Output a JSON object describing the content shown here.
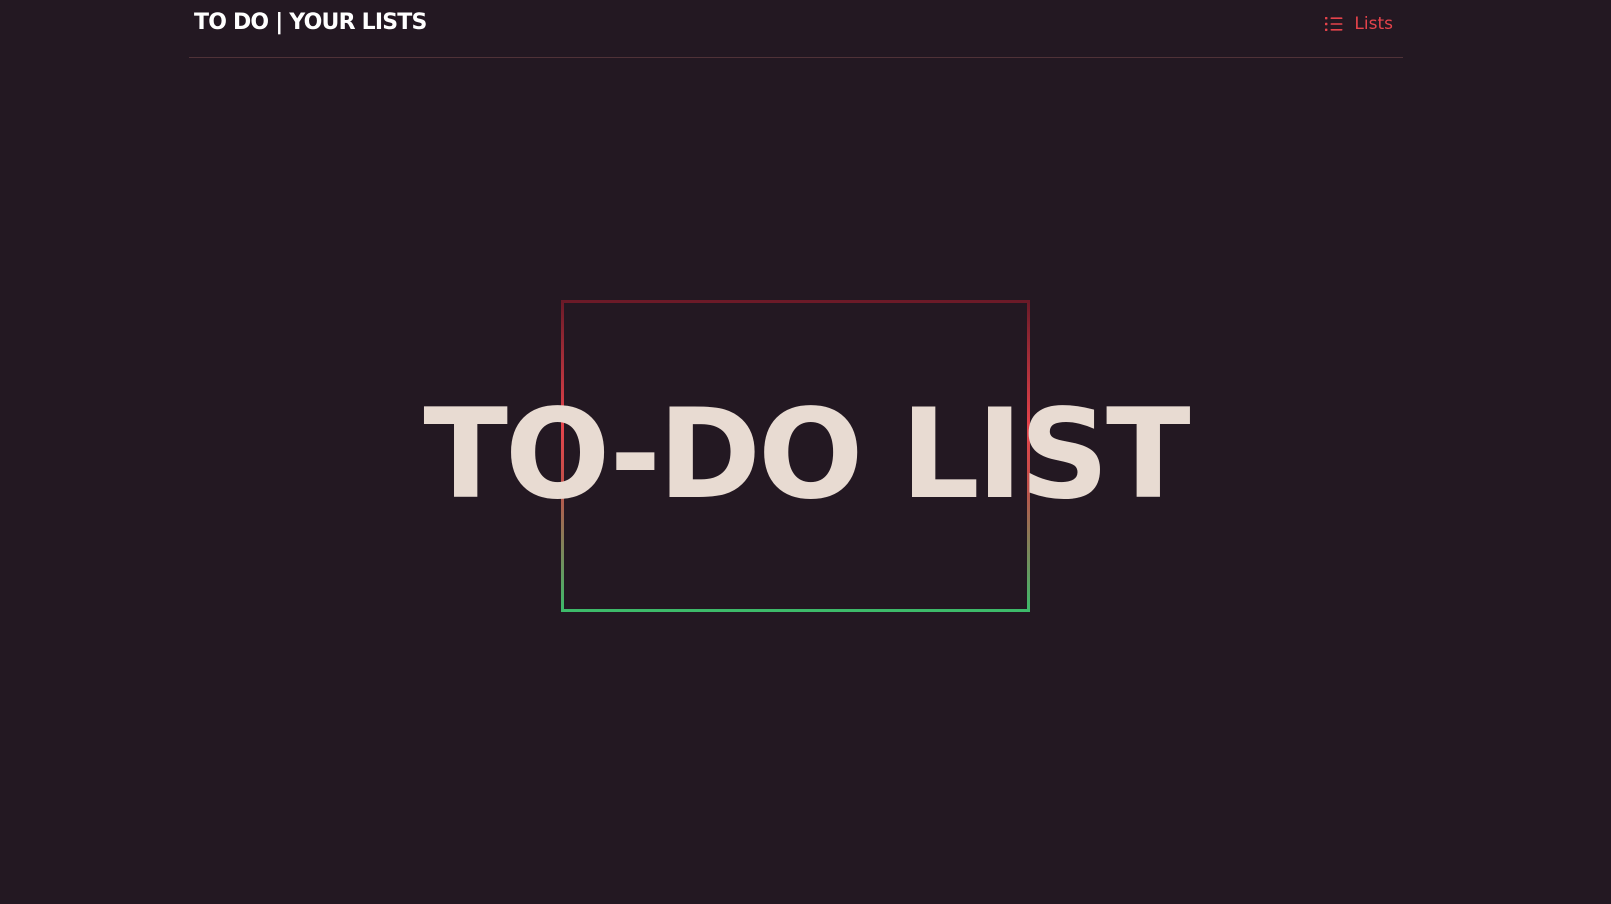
{
  "header": {
    "brand": "TO DO | YOUR LISTS",
    "nav_link_label": "Lists",
    "nav_link_icon": "list-icon"
  },
  "hero": {
    "title": "TO-DO LIST",
    "frame_gradient": [
      "#6b1a28",
      "#e5434b",
      "#3dba6a"
    ]
  },
  "colors": {
    "background": "#231822",
    "accent": "#e5434b",
    "title_text": "#e8dbd2",
    "brand_text": "#ffffff"
  }
}
